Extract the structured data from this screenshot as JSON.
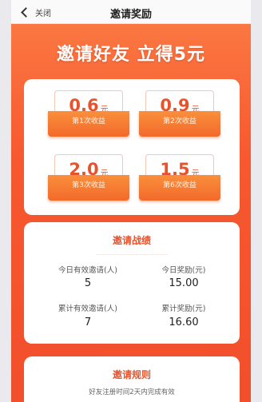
{
  "nav": {
    "back_label": "关闭",
    "title": "邀请奖励"
  },
  "banner": {
    "text": "邀请好友 立得5元"
  },
  "rewards": [
    {
      "value": "0.6",
      "unit": "元",
      "label": "第1次收益"
    },
    {
      "value": "0.9",
      "unit": "元",
      "label": "第2次收益"
    },
    {
      "value": "2.0",
      "unit": "元",
      "label": "第3次收益"
    },
    {
      "value": "1.5",
      "unit": "元",
      "label": "第6次收益"
    }
  ],
  "stats": {
    "title": "邀请战绩",
    "items": [
      {
        "label": "今日有效邀请(人)",
        "value": "5"
      },
      {
        "label": "今日奖励(元)",
        "value": "15.00"
      },
      {
        "label": "累计有效邀请(人)",
        "value": "7"
      },
      {
        "label": "累计奖励(元)",
        "value": "16.60"
      }
    ]
  },
  "rules": {
    "title": "邀请规则",
    "text": "好友注册时间2天内完成有效"
  },
  "colors": {
    "accent": "#e8532b",
    "banner_bg": "#f7582f",
    "envelope": "#f26a2a"
  }
}
